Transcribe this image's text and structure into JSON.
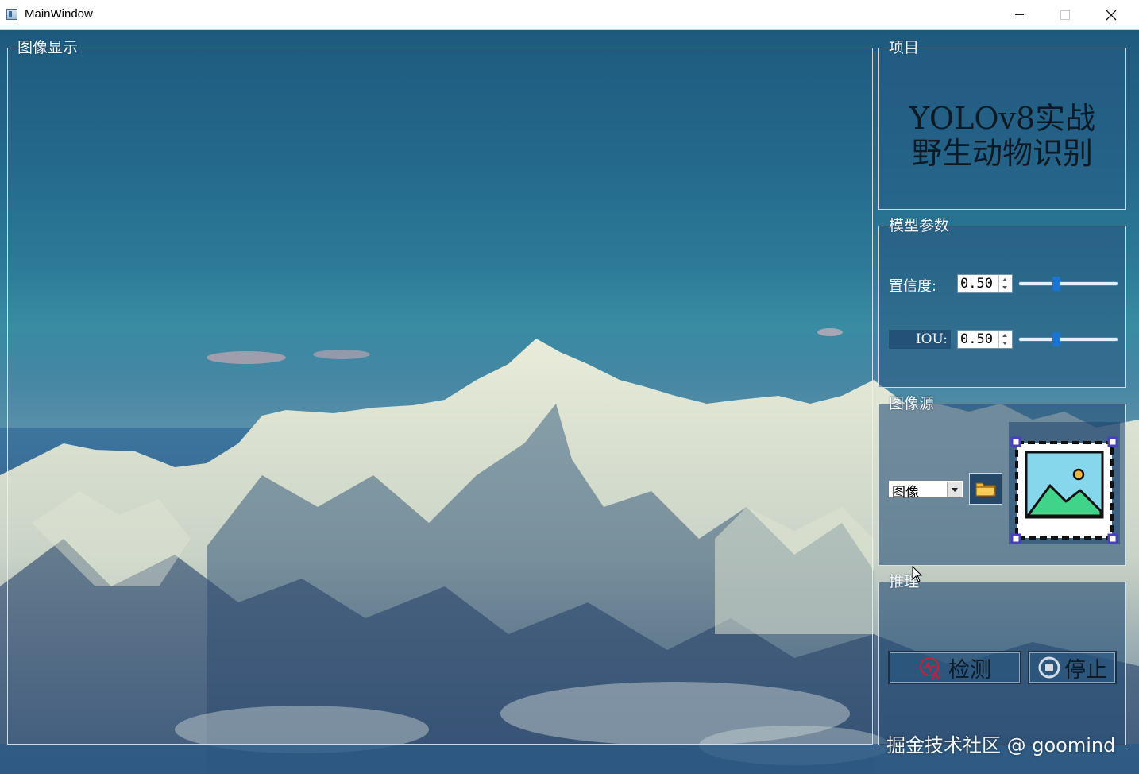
{
  "window": {
    "title": "MainWindow"
  },
  "image_display": {
    "title": "图像显示"
  },
  "project": {
    "title": "项目",
    "heading_line1": "YOLOv8实战",
    "heading_line2": "野生动物识别"
  },
  "params": {
    "title": "模型参数",
    "confidence_label": "置信度:",
    "confidence_value": "0.50",
    "iou_label": "IOU:",
    "iou_value": "0.50",
    "confidence_slider_fraction": 0.38,
    "iou_slider_fraction": 0.38,
    "slider_color": "#1a73d6"
  },
  "source": {
    "title": "图像源",
    "selected": "图像",
    "folder_icon": "folder-icon",
    "preview_icon": "image-placeholder-icon"
  },
  "inference": {
    "title": "推理",
    "detect_label": "检测",
    "stop_label": "停止"
  },
  "watermark": "掘金技术社区 @ goomind"
}
